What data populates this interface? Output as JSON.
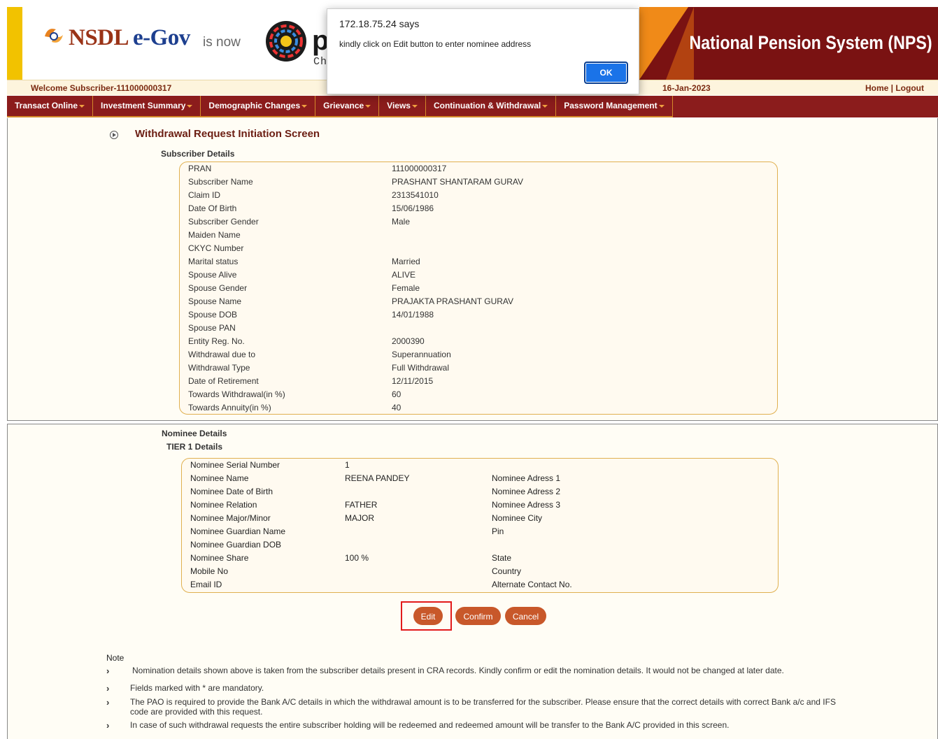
{
  "header": {
    "logo_text_1": "NSDL",
    "logo_text_2": "e-Gov",
    "is_now": "is now",
    "protean": "pr",
    "protean_sub": "Chan",
    "nps_title": "National Pension System (NPS)",
    "welcome": "Welcome Subscriber-111000000317",
    "date": "16-Jan-2023",
    "home": "Home",
    "sep": "|",
    "logout": "Logout"
  },
  "nav": [
    "Transact Online",
    "Investment Summary",
    "Demographic Changes",
    "Grievance",
    "Views",
    "Continuation & Withdrawal",
    "Password Management"
  ],
  "screen_title": "Withdrawal Request Initiation Screen",
  "subscriber_heading": "Subscriber Details",
  "subscriber": [
    {
      "label": "PRAN",
      "value": "111000000317"
    },
    {
      "label": "Subscriber Name",
      "value": "PRASHANT SHANTARAM GURAV"
    },
    {
      "label": "Claim ID",
      "value": "2313541010"
    },
    {
      "label": "Date Of Birth",
      "value": "15/06/1986"
    },
    {
      "label": "Subscriber Gender",
      "value": "Male"
    },
    {
      "label": "Maiden Name",
      "value": ""
    },
    {
      "label": "CKYC Number",
      "value": ""
    },
    {
      "label": "Marital status",
      "value": "Married"
    },
    {
      "label": "Spouse Alive",
      "value": "ALIVE"
    },
    {
      "label": "Spouse Gender",
      "value": "Female"
    },
    {
      "label": "Spouse Name",
      "value": "PRAJAKTA PRASHANT GURAV"
    },
    {
      "label": "Spouse DOB",
      "value": "14/01/1988"
    },
    {
      "label": "Spouse PAN",
      "value": ""
    },
    {
      "label": "Entity Reg. No.",
      "value": "2000390"
    },
    {
      "label": "Withdrawal due to",
      "value": "Superannuation"
    },
    {
      "label": "Withdrawal Type",
      "value": "Full Withdrawal"
    },
    {
      "label": "Date of Retirement",
      "value": "12/11/2015"
    },
    {
      "label": "Towards Withdrawal(in %)",
      "value": "60"
    },
    {
      "label": "Towards Annuity(in %)",
      "value": "40"
    }
  ],
  "nominee_heading": "Nominee Details",
  "tier_heading": "TIER 1 Details",
  "nominee": [
    {
      "label": "Nominee Serial Number",
      "value": "1",
      "label2": ""
    },
    {
      "label": "Nominee Name",
      "value": "REENA PANDEY",
      "label2": "Nominee Adress 1"
    },
    {
      "label": "Nominee Date of Birth",
      "value": "",
      "label2": "Nominee Adress 2"
    },
    {
      "label": "Nominee Relation",
      "value": "FATHER",
      "label2": "Nominee Adress 3"
    },
    {
      "label": "Nominee Major/Minor",
      "value": "MAJOR",
      "label2": "Nominee City"
    },
    {
      "label": "Nominee Guardian Name",
      "value": "",
      "label2": "Pin"
    },
    {
      "label": "Nominee Guardian DOB",
      "value": "",
      "label2": ""
    },
    {
      "label": "Nominee Share",
      "value": "100 %",
      "label2": "State"
    },
    {
      "label": "Mobile No",
      "value": "",
      "label2": "Country"
    },
    {
      "label": "Email ID",
      "value": "",
      "label2": "Alternate Contact No."
    }
  ],
  "buttons": {
    "edit": "Edit",
    "confirm": "Confirm",
    "cancel": "Cancel"
  },
  "note_label": "Note",
  "notes": [
    "Nomination details shown above is taken from the subscriber details present in CRA records. Kindly confirm or edit the nomination details. It would not be changed at later date.",
    "Fields marked with * are mandatory.",
    "The PAO is required to provide the Bank A/C details in which the withdrawal amount is to be transferred for the subscriber. Please ensure that the correct details with correct Bank a/c and IFS code are provided with this request.",
    "In case of such withdrawal requests the entire subscriber holding will be redeemed and redeemed amount will be transfer to the Bank A/C provided in this screen."
  ],
  "note_arrow": "›",
  "alert": {
    "title": "172.18.75.24 says",
    "message": "kindly click on Edit button to enter nominee address",
    "ok": "OK"
  },
  "colors": {
    "nav_bg": "#8b1c1c",
    "button": "#c8582a",
    "accent": "#7b2a11",
    "highlight": "#e21b1b"
  }
}
